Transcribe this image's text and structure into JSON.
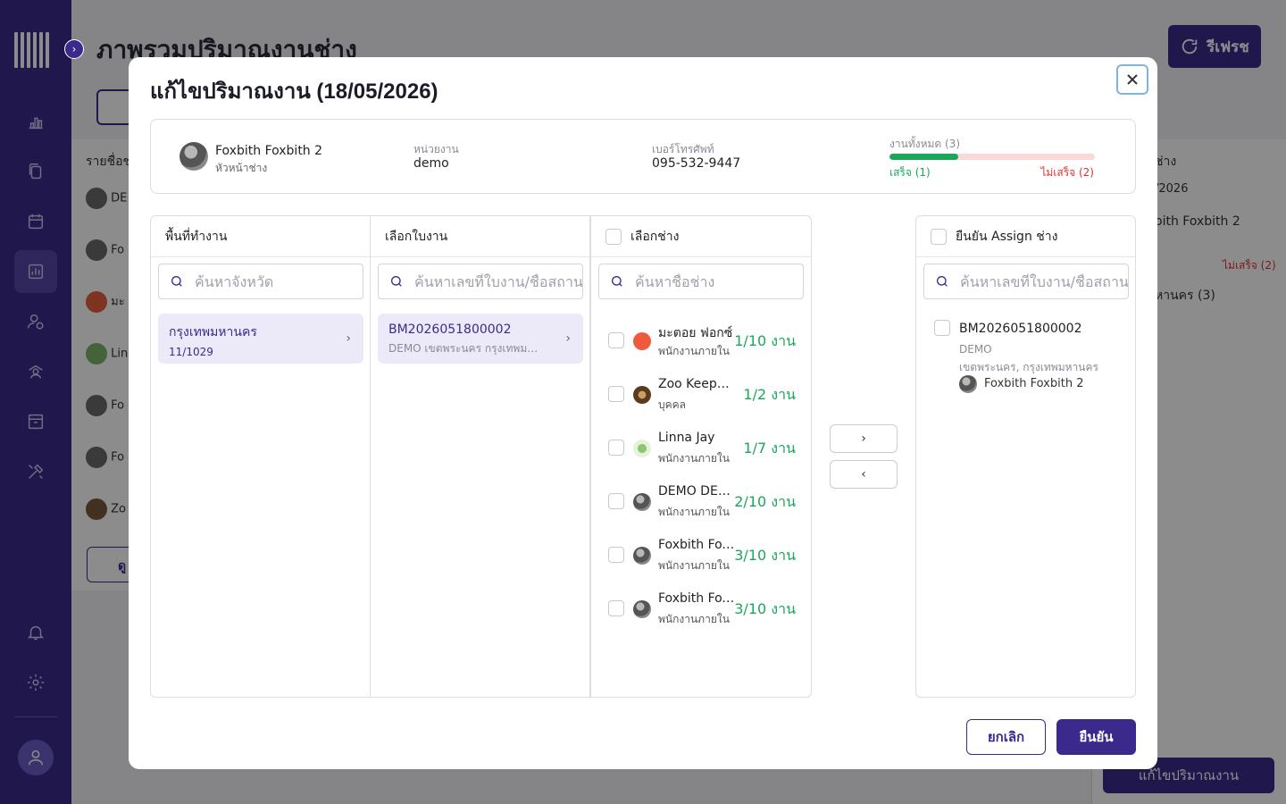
{
  "background": {
    "page_title": "ภาพรวมปริมาณงานช่าง",
    "refresh_label": "รีเฟรช",
    "table_header": "รายชื่อช่",
    "row_labels": [
      "DE",
      "Fo",
      "มะ",
      "Lin",
      "Fo",
      "Fo",
      "Zo"
    ],
    "view_button": "ดู",
    "right_header": "ช่าง",
    "right_date": "/2026",
    "right_name": "oith Foxbith 2",
    "right_notdone": "ไม่เสร็จ (2)",
    "right_province": "หานคร (3)",
    "edit_button": "แก้ไขปริมาณงาน"
  },
  "modal": {
    "title": "แก้ไขปริมาณงาน (18/05/2026)",
    "lead": {
      "name": "Foxbith Foxbith 2",
      "role": "หัวหน้าช่าง",
      "unit_label": "หน่วยงาน",
      "unit_value": "demo",
      "phone_label": "เบอร์โทรศัพท์",
      "phone_value": "095-532-9447",
      "total_label": "งานทั้งหมด (3)",
      "done_label": "เสร็จ (1)",
      "notdone_label": "ไม่เสร็จ (2)",
      "progress_fraction": 0.333
    },
    "area_panel": {
      "header": "พื้นที่ทำงาน",
      "search_placeholder": "ค้นหาจังหวัด",
      "selected": {
        "name": "กรุงเทพมหานคร",
        "sub": "11/1029"
      }
    },
    "job_panel": {
      "header": "เลือกใบงาน",
      "search_placeholder": "ค้นหาเลขที่ใบงาน/ชื่อสถาน",
      "selected": {
        "id": "BM2026051800002",
        "sub": "DEMO เขตพระนคร กรุงเทพมหานคร"
      }
    },
    "tech_panel": {
      "header": "เลือกช่าง",
      "search_placeholder": "ค้นหาชื่อช่าง",
      "technicians": [
        {
          "name": "มะตอย ฟอกซ์",
          "role": "พนักงานภายใน",
          "count": "1/10 งาน",
          "avatar": "orange-logo"
        },
        {
          "name": "Zoo Keeper1",
          "role": "บุคคล",
          "count": "1/2 งาน",
          "avatar": "photo"
        },
        {
          "name": "Linna Jay",
          "role": "พนักงานภายใน",
          "count": "1/7 งาน",
          "avatar": "green-figure"
        },
        {
          "name": "DEMO DEMO",
          "role": "พนักงานภายใน",
          "count": "2/10 งาน",
          "avatar": "photo"
        },
        {
          "name": "Foxbith Foxbith",
          "role": "พนักงานภายใน",
          "count": "3/10 งาน",
          "avatar": "photo"
        },
        {
          "name": "Foxbith Foxbith",
          "role": "พนักงานภายใน",
          "count": "3/10 งาน",
          "avatar": "photo"
        }
      ]
    },
    "move_right_icon": "chevron-right-icon",
    "move_left_icon": "chevron-left-icon",
    "assign_panel": {
      "header": "ยืนยัน Assign ช่าง",
      "search_placeholder": "ค้นหาเลขที่ใบงาน/ชื่อสถาน",
      "item": {
        "id": "BM2026051800002",
        "org": "DEMO",
        "location": "เขตพระนคร, กรุงเทพมหานคร",
        "tech": "Foxbith Foxbith 2"
      }
    },
    "cancel_label": "ยกเลิก",
    "confirm_label": "ยืนยัน"
  },
  "colors": {
    "primary": "#3b2a8c",
    "success": "#19a85a",
    "danger": "#e03131"
  }
}
